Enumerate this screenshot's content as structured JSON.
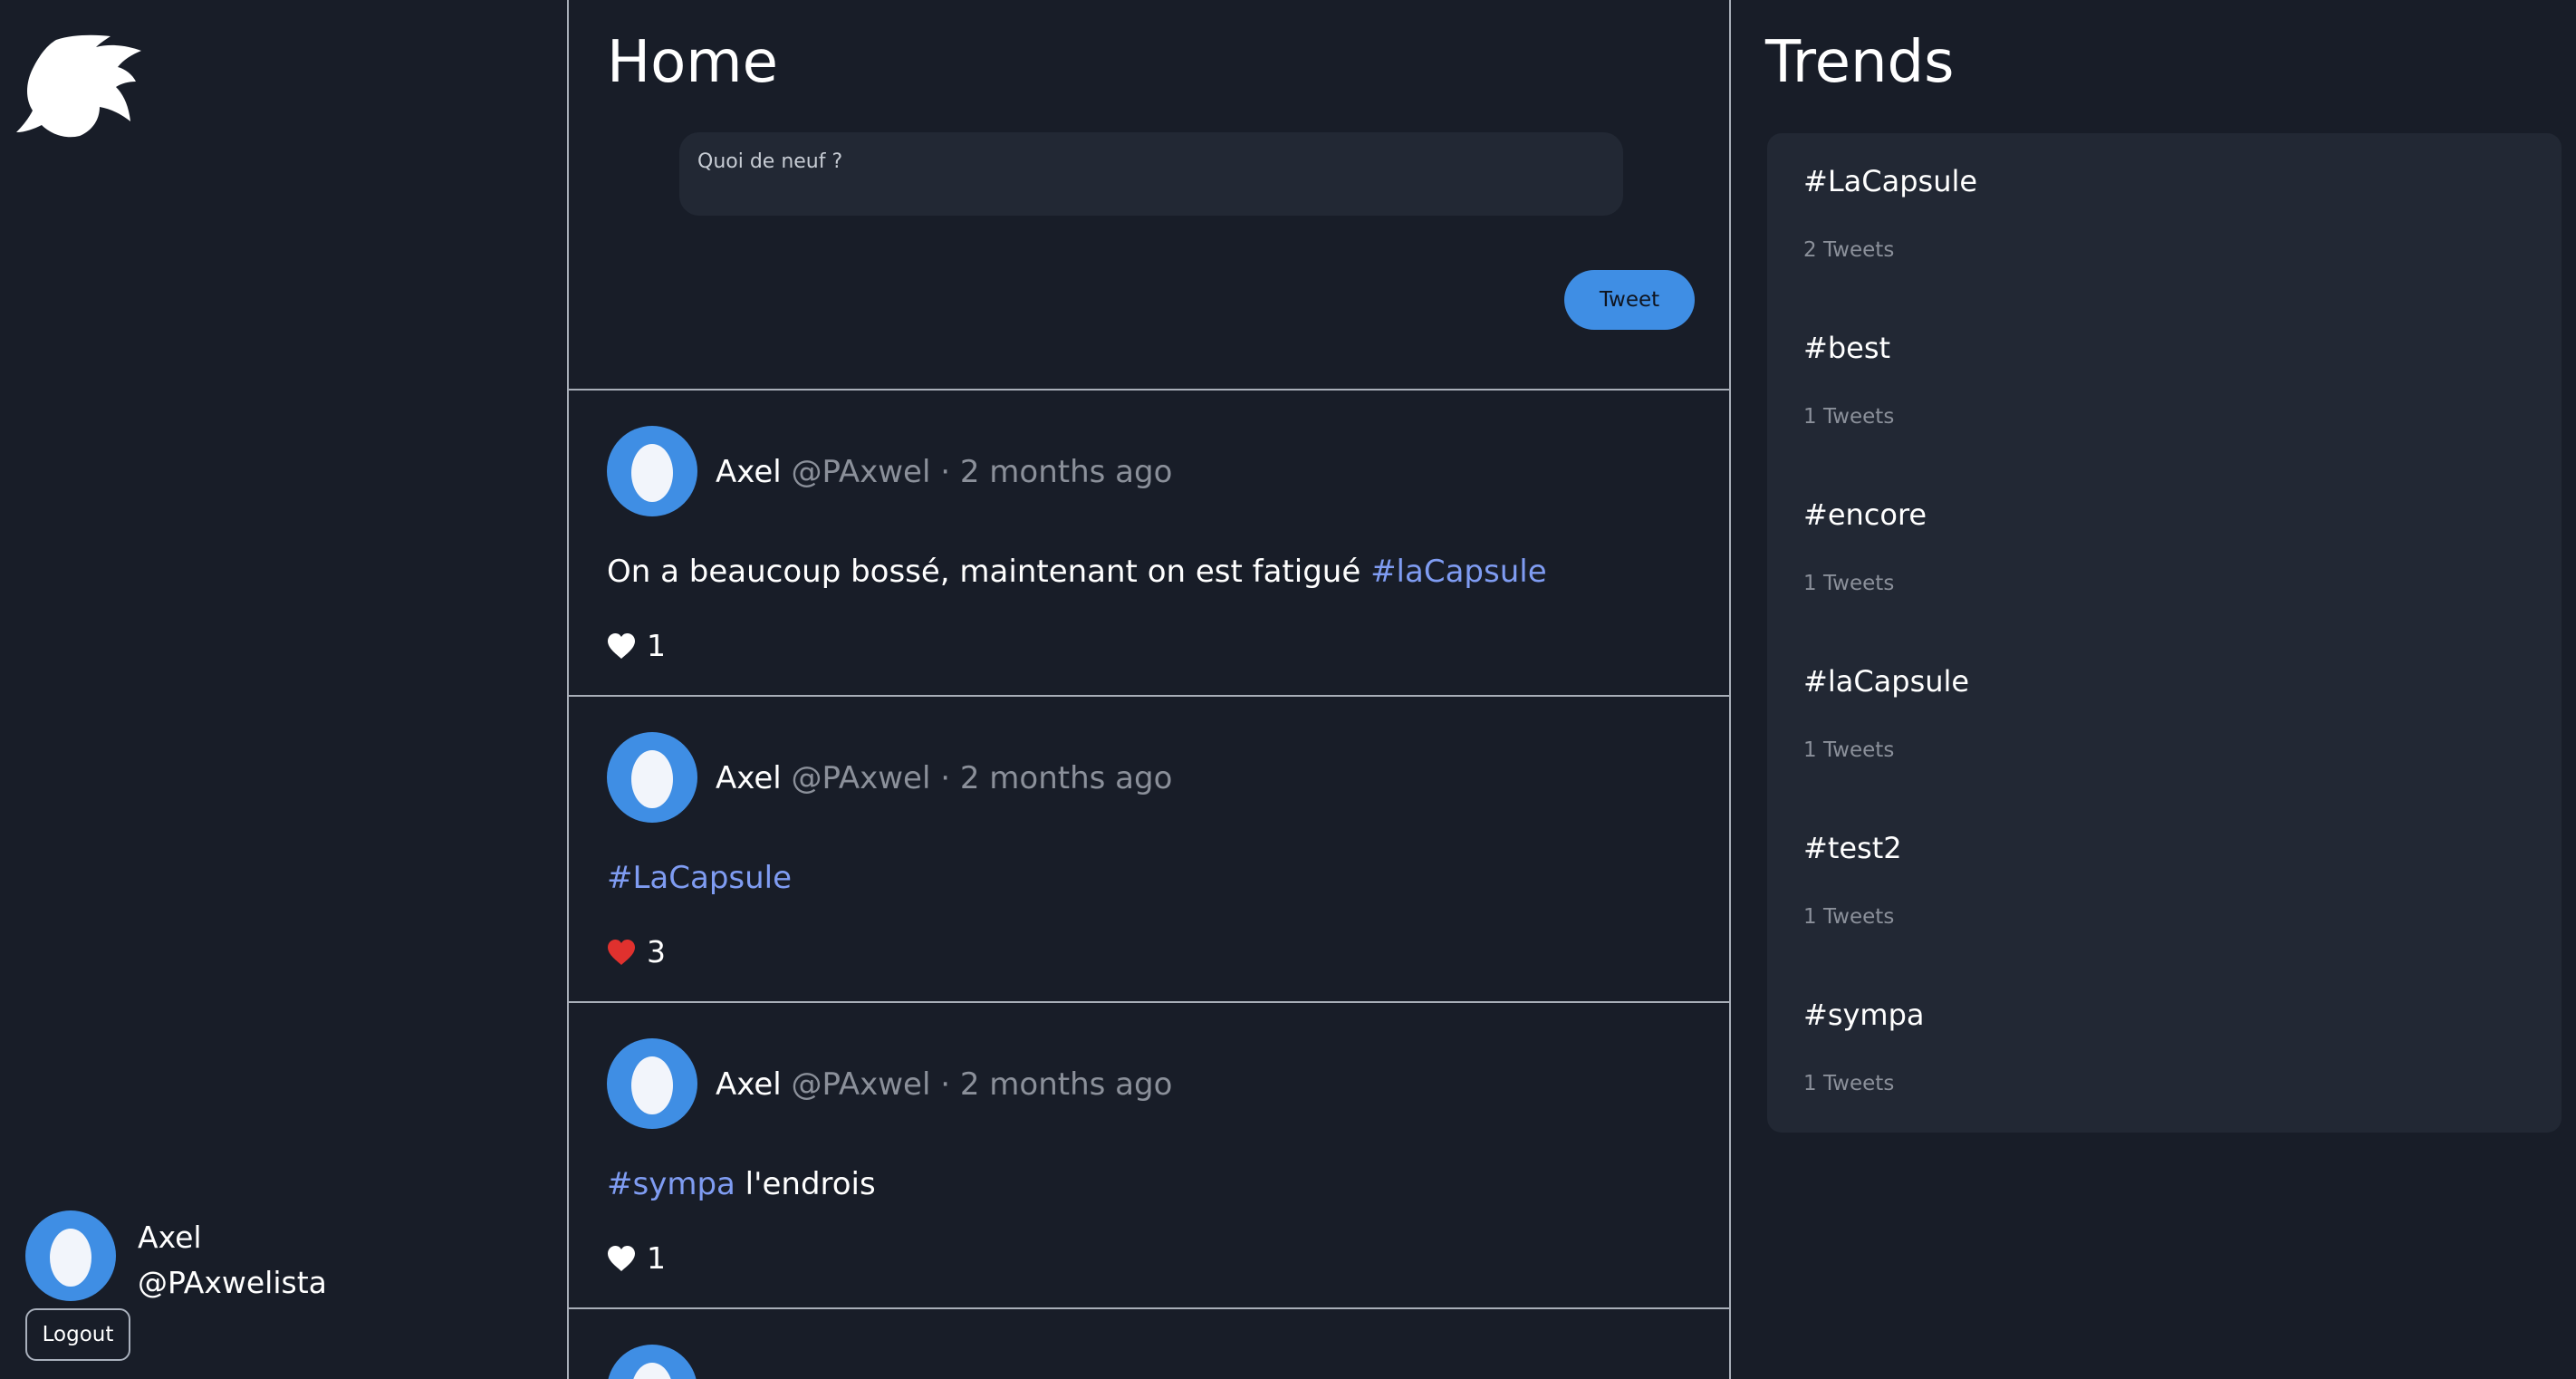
{
  "sidebar": {
    "user": {
      "name": "Axel",
      "handle": "@PAxwelista"
    },
    "logout_label": "Logout"
  },
  "feed": {
    "title": "Home",
    "compose": {
      "placeholder": "Quoi de neuf ?",
      "value": ""
    },
    "tweet_button_label": "Tweet",
    "tweets": [
      {
        "author": "Axel",
        "handle": "@PAxwel",
        "separator": "·",
        "time": "2 months ago",
        "text_before": "On a beaucoup bossé, maintenant on est fatigué ",
        "hashtag": "#laCapsule",
        "text_after": "",
        "likes": "1",
        "liked": false
      },
      {
        "author": "Axel",
        "handle": "@PAxwel",
        "separator": "·",
        "time": "2 months ago",
        "text_before": "",
        "hashtag": "#LaCapsule",
        "text_after": "",
        "likes": "3",
        "liked": true
      },
      {
        "author": "Axel",
        "handle": "@PAxwel",
        "separator": "·",
        "time": "2 months ago",
        "text_before": "",
        "hashtag": "#sympa",
        "text_after": " l'endrois",
        "likes": "1",
        "liked": false
      }
    ]
  },
  "trends": {
    "title": "Trends",
    "items": [
      {
        "tag": "#LaCapsule",
        "count": "2 Tweets"
      },
      {
        "tag": "#best",
        "count": "1 Tweets"
      },
      {
        "tag": "#encore",
        "count": "1 Tweets"
      },
      {
        "tag": "#laCapsule",
        "count": "1 Tweets"
      },
      {
        "tag": "#test2",
        "count": "1 Tweets"
      },
      {
        "tag": "#sympa",
        "count": "1 Tweets"
      }
    ]
  },
  "colors": {
    "background": "#181d28",
    "panel": "#222834",
    "accent": "#3f8ee4",
    "hashtag": "#7f9cf2",
    "muted": "#8b909a",
    "like_active": "#e0312e"
  },
  "icons": [
    "bird-logo-icon",
    "egg-avatar-icon",
    "heart-icon"
  ]
}
